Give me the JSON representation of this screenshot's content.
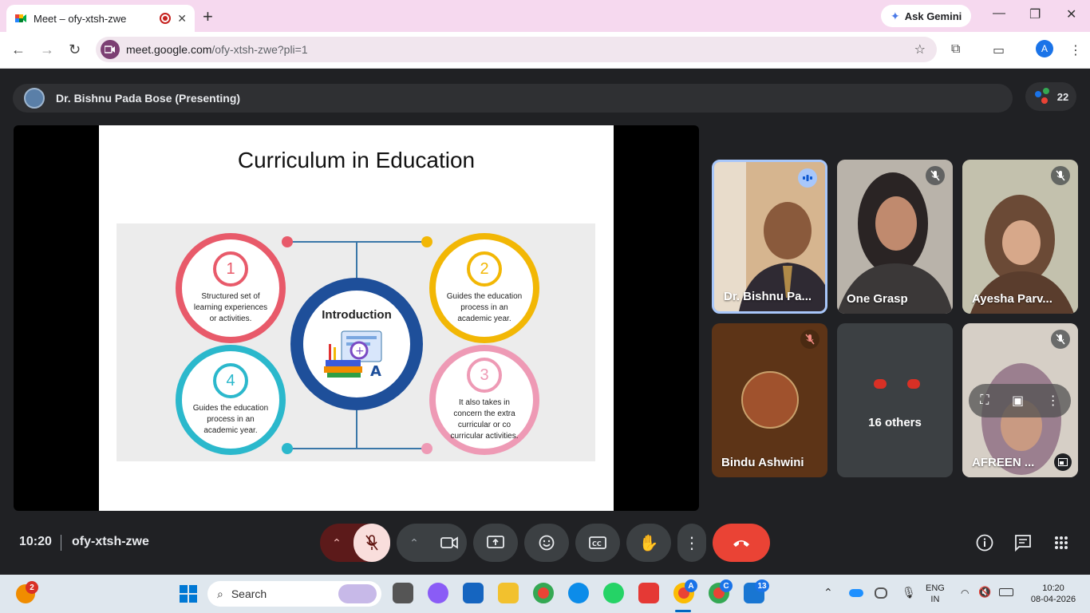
{
  "browser": {
    "tab_title": "Meet – ofy-xtsh-zwe",
    "ask_gemini": "Ask Gemini",
    "url_host": "meet.google.com",
    "url_path": "/ofy-xtsh-zwe?pli=1",
    "profile_initial": "A"
  },
  "meeting": {
    "presenter_label": "Dr. Bishnu Pada Bose (Presenting)",
    "participant_count": "22",
    "time": "10:20",
    "code": "ofy-xtsh-zwe"
  },
  "slide": {
    "title": "Curriculum in Education",
    "center_label": "Introduction",
    "items": [
      {
        "num": "1",
        "text": "Structured set of learning experiences or activities.",
        "color": "#e85a6a"
      },
      {
        "num": "2",
        "text": "Guides the education process in an academic year.",
        "color": "#f2b705"
      },
      {
        "num": "3",
        "text": "It also takes in concern the extra curricular or co curricular activities.",
        "color": "#ee9ab5"
      },
      {
        "num": "4",
        "text": "Guides the education process in an academic year.",
        "color": "#2bb8cc"
      }
    ]
  },
  "tiles": [
    {
      "name": "Dr. Bishnu Pa...",
      "speaking": true
    },
    {
      "name": "One Grasp",
      "muted": true
    },
    {
      "name": "Ayesha Parv...",
      "muted": true
    },
    {
      "name": "Bindu Ashwini",
      "muted": true
    },
    {
      "name": "16 others"
    },
    {
      "name": "AFREEN ...",
      "muted": true
    }
  ],
  "taskbar": {
    "search_placeholder": "Search",
    "notification_count": "2",
    "chrome_badge_a": "A",
    "chrome_badge_c": "C",
    "teams_badge": "13",
    "lang_line1": "ENG",
    "lang_line2": "IN",
    "clock_time": "10:20",
    "clock_date": "08-04-2026"
  },
  "icons": {
    "back": "arrow-left-icon",
    "forward": "arrow-right-icon",
    "reload": "reload-icon",
    "bookmark": "star-icon",
    "extensions": "puzzle-icon",
    "mic_off": "mic-off-icon",
    "camera": "camera-icon",
    "present": "present-icon",
    "emoji": "emoji-icon",
    "captions": "captions-icon",
    "raise_hand": "hand-icon",
    "more": "more-vert-icon",
    "hangup": "end-call-icon",
    "info": "info-icon",
    "chat": "chat-icon",
    "apps": "apps-grid-icon"
  },
  "colors": {
    "hangup": "#ea4335",
    "mic_off_bg": "#f9dedc",
    "accent": "#1a73e8"
  }
}
